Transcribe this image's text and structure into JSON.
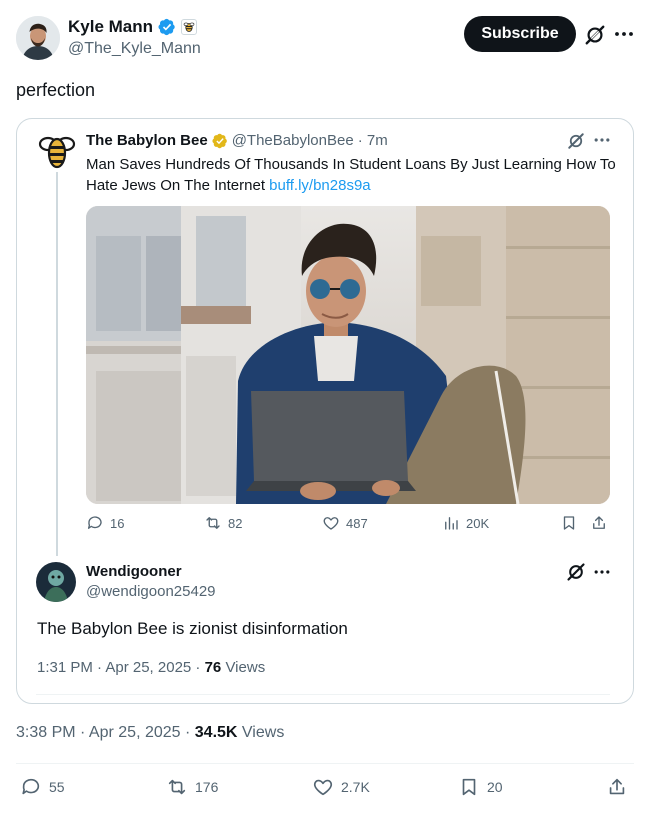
{
  "author": {
    "name": "Kyle Mann",
    "handle": "@The_Kyle_Mann",
    "subscribe_label": "Subscribe"
  },
  "tweet": {
    "text": "perfection",
    "timestamp": "3:38 PM · Apr 25, 2025 · ",
    "views_count": "34.5K",
    "views_label": "Views",
    "actions": {
      "replies": "55",
      "retweets": "176",
      "likes": "2.7K",
      "bookmarks": "20"
    }
  },
  "quoted": {
    "name": "The Babylon Bee",
    "handle": "@TheBabylonBee",
    "time": "· 7m",
    "text": "Man Saves Hundreds Of Thousands In Student Loans By Just Learning How To Hate Jews On The Internet ",
    "link": "buff.ly/bn28s9a",
    "actions": {
      "replies": "16",
      "retweets": "82",
      "likes": "487",
      "views": "20K"
    }
  },
  "reply": {
    "name": "Wendigooner",
    "handle": "@wendigoon25429",
    "text": "The Babylon Bee is zionist disinformation",
    "timestamp": "1:31 PM · Apr 25, 2025 · ",
    "views_count": "76",
    "views_label": "Views"
  },
  "colors": {
    "accent": "#1d9bf0",
    "text": "#0f1419",
    "muted": "#536471",
    "border": "#cfd9de",
    "gold": "#e8b43a"
  },
  "icons": [
    "verified-badge-icon",
    "affiliate-bee-badge-icon",
    "grok-icon",
    "more-icon",
    "reply-icon",
    "retweet-icon",
    "like-icon",
    "views-icon",
    "bookmark-icon",
    "share-icon"
  ]
}
